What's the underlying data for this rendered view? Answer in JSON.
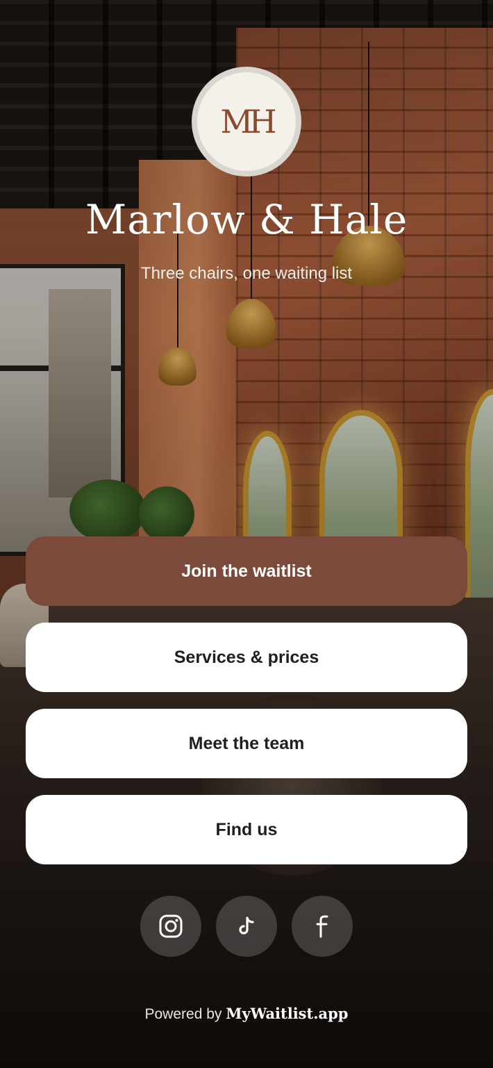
{
  "logo": {
    "monogram": "MH"
  },
  "header": {
    "title": "Marlow & Hale",
    "subtitle": "Three chairs, one waiting list"
  },
  "actions": [
    {
      "label": "Join the waitlist",
      "style": "primary"
    },
    {
      "label": "Services & prices",
      "style": "secondary"
    },
    {
      "label": "Meet the team",
      "style": "secondary"
    },
    {
      "label": "Find us",
      "style": "secondary"
    }
  ],
  "social": [
    {
      "icon": "instagram-icon"
    },
    {
      "icon": "tiktok-icon"
    },
    {
      "icon": "facebook-icon"
    }
  ],
  "footer": {
    "prefix": "Powered by",
    "brand": "MyWaitlist.app"
  },
  "colors": {
    "primary_button": "#7b4a3b",
    "secondary_button": "#ffffff",
    "logo_accent": "#8a4a2a"
  }
}
